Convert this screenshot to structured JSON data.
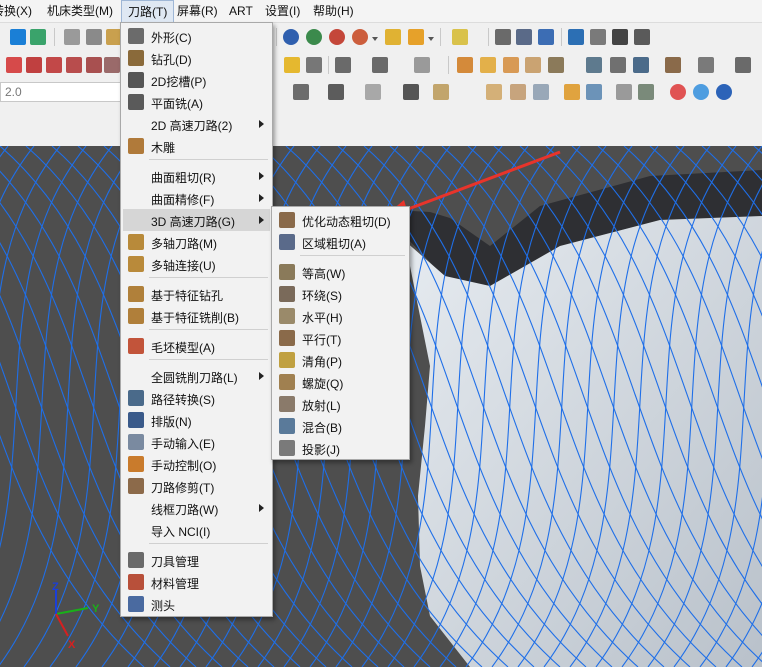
{
  "menubar": [
    {
      "label": "转换(X)"
    },
    {
      "label": "机床类型(M)"
    },
    {
      "label": "刀路(T)"
    },
    {
      "label": "屏幕(R)"
    },
    {
      "label": "ART"
    },
    {
      "label": "设置(I)"
    },
    {
      "label": "帮助(H)"
    }
  ],
  "coordinate_field": {
    "value": "2.0"
  },
  "toolpaths_menu": {
    "items": [
      {
        "label": "外形(C)",
        "icon": "contour-icon"
      },
      {
        "label": "钻孔(D)",
        "icon": "drill-icon"
      },
      {
        "label": "2D挖槽(P)",
        "icon": "pocket-icon"
      },
      {
        "label": "平面铣(A)",
        "icon": "facing-icon"
      },
      {
        "label": "2D 高速刀路(2)",
        "icon": "none",
        "submenu": true
      },
      {
        "label": "木雕",
        "icon": "engrave-icon"
      },
      {
        "label": "曲面粗切(R)",
        "icon": "none",
        "submenu": true
      },
      {
        "label": "曲面精修(F)",
        "icon": "none",
        "submenu": true
      },
      {
        "label": "3D 高速刀路(G)",
        "icon": "none",
        "submenu": true,
        "highlighted": true
      },
      {
        "label": "多轴刀路(M)",
        "icon": "multiaxis-icon"
      },
      {
        "label": "多轴连接(U)",
        "icon": "multiaxis-link-icon"
      },
      {
        "label": "基于特征钻孔",
        "icon": "feature-drill-icon"
      },
      {
        "label": "基于特征铣削(B)",
        "icon": "feature-mill-icon"
      },
      {
        "label": "毛坯模型(A)",
        "icon": "stock-model-icon"
      },
      {
        "label": "全圆铣削刀路(L)",
        "icon": "none",
        "submenu": true
      },
      {
        "label": "路径转换(S)",
        "icon": "transform-icon"
      },
      {
        "label": "排版(N)",
        "icon": "nesting-icon"
      },
      {
        "label": "手动输入(E)",
        "icon": "manual-entry-icon"
      },
      {
        "label": "手动控制(O)",
        "icon": "manual-control-icon"
      },
      {
        "label": "刀路修剪(T)",
        "icon": "trim-icon"
      },
      {
        "label": "线框刀路(W)",
        "icon": "none",
        "submenu": true
      },
      {
        "label": "导入 NCI(I)",
        "icon": "none"
      },
      {
        "label": "刀具管理",
        "icon": "tool-manager-icon"
      },
      {
        "label": "材料管理",
        "icon": "material-manager-icon"
      },
      {
        "label": "测头",
        "icon": "probe-icon"
      }
    ]
  },
  "hst3d_submenu": {
    "items": [
      {
        "label": "优化动态粗切(D)",
        "icon": "dynamic-opti-rough-icon"
      },
      {
        "label": "区域粗切(A)",
        "icon": "area-rough-icon"
      },
      {
        "label": "等高(W)",
        "icon": "waterline-icon"
      },
      {
        "label": "环绕(S)",
        "icon": "scallop-icon"
      },
      {
        "label": "水平(H)",
        "icon": "horizontal-icon"
      },
      {
        "label": "平行(T)",
        "icon": "raster-icon"
      },
      {
        "label": "清角(P)",
        "icon": "pencil-icon"
      },
      {
        "label": "螺旋(Q)",
        "icon": "spiral-icon"
      },
      {
        "label": "放射(L)",
        "icon": "radial-icon"
      },
      {
        "label": "混合(B)",
        "icon": "hybrid-icon"
      },
      {
        "label": "投影(J)",
        "icon": "project-icon"
      }
    ]
  },
  "axis_triad": {
    "x": "X",
    "y": "Y",
    "z": "Z"
  },
  "colors": {
    "toolpath": "#1f6fe8",
    "viewport_bg": "#4e4e4e",
    "arrow": "#e8342b",
    "x_axis": "#d62020",
    "y_axis": "#19b019",
    "z_axis": "#1b3fd9"
  }
}
